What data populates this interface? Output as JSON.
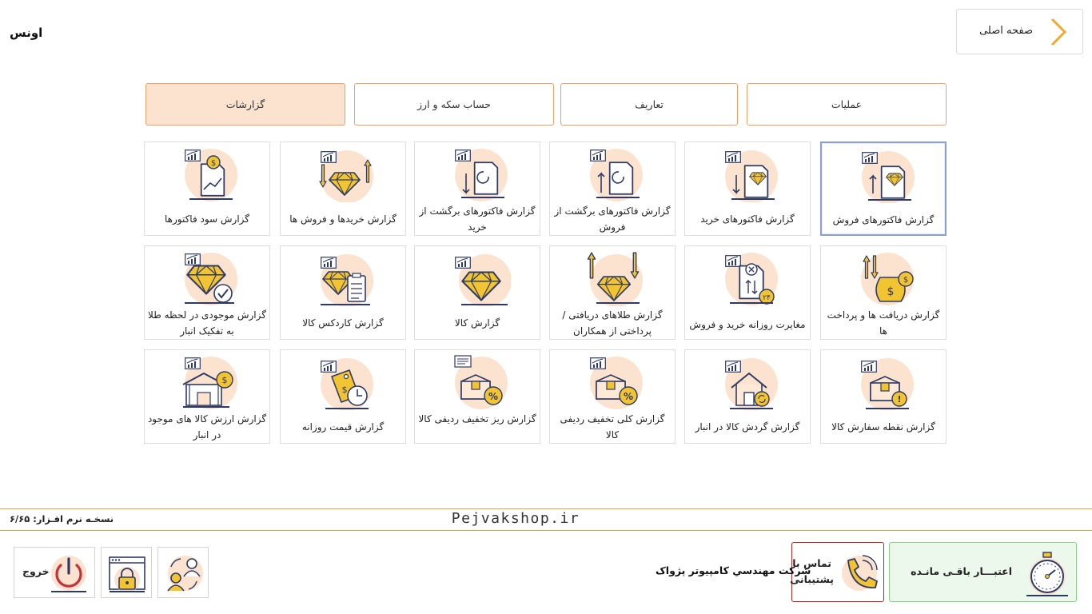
{
  "app": {
    "title": "اونس"
  },
  "header": {
    "home_label": "صفحه اصلی"
  },
  "tabs": [
    {
      "label": "عملیات",
      "active": false
    },
    {
      "label": "تعاریف",
      "active": false
    },
    {
      "label": "حساب سکه و ارز",
      "active": false
    },
    {
      "label": "گزارشات",
      "active": true
    }
  ],
  "tiles": [
    {
      "label": "گزارش فاکتورهای فروش",
      "icon": "sales-invoice-icon",
      "selected": true
    },
    {
      "label": "گزارش فاکتورهای خرید",
      "icon": "purchase-invoice-icon"
    },
    {
      "label": "گزارش فاکتورهای برگشت از فروش",
      "icon": "sales-return-icon"
    },
    {
      "label": "گزارش فاکتورهای برگشت از خرید",
      "icon": "purchase-return-icon"
    },
    {
      "label": "گزارش خریدها و فروش ها",
      "icon": "buy-sell-icon"
    },
    {
      "label": "گزارش سود فاکتورها",
      "icon": "invoice-profit-icon"
    },
    {
      "label": "گزارش دریافت ها و پرداخت ها",
      "icon": "money-bag-icon"
    },
    {
      "label": "مغایرت روزانه خرید و فروش",
      "icon": "daily-discrepancy-icon"
    },
    {
      "label": "گزارش طلاهای دریافتی / پرداختی از همکاران",
      "icon": "gold-exchange-icon"
    },
    {
      "label": "گزارش کالا",
      "icon": "diamond-icon"
    },
    {
      "label": "گزارش کاردکس کالا",
      "icon": "cardex-icon"
    },
    {
      "label": "گزارش موجودی در لحظه طلا به تفکیک انبار",
      "icon": "diamond-check-icon"
    },
    {
      "label": "گزارش نقطه سفارش کالا",
      "icon": "box-alert-icon"
    },
    {
      "label": "گزارش گردش کالا در انبار",
      "icon": "house-refresh-icon"
    },
    {
      "label": "گزارش کلی تخفیف ردیفی کالا",
      "icon": "box-discount-icon"
    },
    {
      "label": "گزارش ریز تخفیف ردیفی کالا",
      "icon": "box-discount-detail-icon"
    },
    {
      "label": "گزارش قیمت روزانه",
      "icon": "price-tag-clock-icon"
    },
    {
      "label": "گزارش ارزش کالا های موجود در انبار",
      "icon": "warehouse-value-icon"
    }
  ],
  "footer": {
    "brand": "Pejvakshop.ir",
    "version": "نسخـه نرم افـزار: ۶/۶۵",
    "credit_label": "اعتبـــار باقـی مانـده",
    "support_label": "تماس با پشتیبانی",
    "company": "شرکت مهندسي کامپيوتر پژواک",
    "exit_label": "خروج"
  },
  "colors": {
    "accent": "#e7a16a",
    "tab_active_bg": "#fbe3cf",
    "gold": "#f2c431",
    "navy": "#2f3a64",
    "peach": "#fbe3cf",
    "credit_bg": "#edf8ec",
    "support_border": "#b02a2a",
    "divider": "#d9a441"
  }
}
